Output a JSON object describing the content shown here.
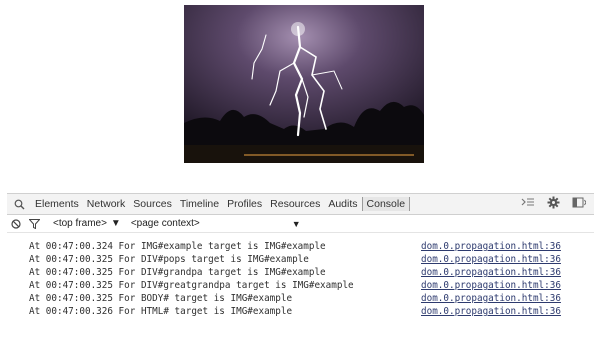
{
  "photo": {
    "alt": "lightning over trees at night"
  },
  "devtools": {
    "tabs": [
      {
        "label": "Elements"
      },
      {
        "label": "Network"
      },
      {
        "label": "Sources"
      },
      {
        "label": "Timeline"
      },
      {
        "label": "Profiles"
      },
      {
        "label": "Resources"
      },
      {
        "label": "Audits"
      },
      {
        "label": "Console"
      }
    ],
    "active_tab": "Console",
    "filter": {
      "frame": "<top frame>",
      "context": "<page context>"
    },
    "console": [
      {
        "message": "At 00:47:00.324 For IMG#example target is IMG#example",
        "source": "dom.0.propagation.html:36"
      },
      {
        "message": "At 00:47:00.325 For DIV#pops target is IMG#example",
        "source": "dom.0.propagation.html:36"
      },
      {
        "message": "At 00:47:00.325 For DIV#grandpa target is IMG#example",
        "source": "dom.0.propagation.html:36"
      },
      {
        "message": "At 00:47:00.325 For DIV#greatgrandpa target is IMG#example",
        "source": "dom.0.propagation.html:36"
      },
      {
        "message": "At 00:47:00.325 For BODY# target is IMG#example",
        "source": "dom.0.propagation.html:36"
      },
      {
        "message": "At 00:47:00.326 For HTML# target is IMG#example",
        "source": "dom.0.propagation.html:36"
      }
    ]
  }
}
